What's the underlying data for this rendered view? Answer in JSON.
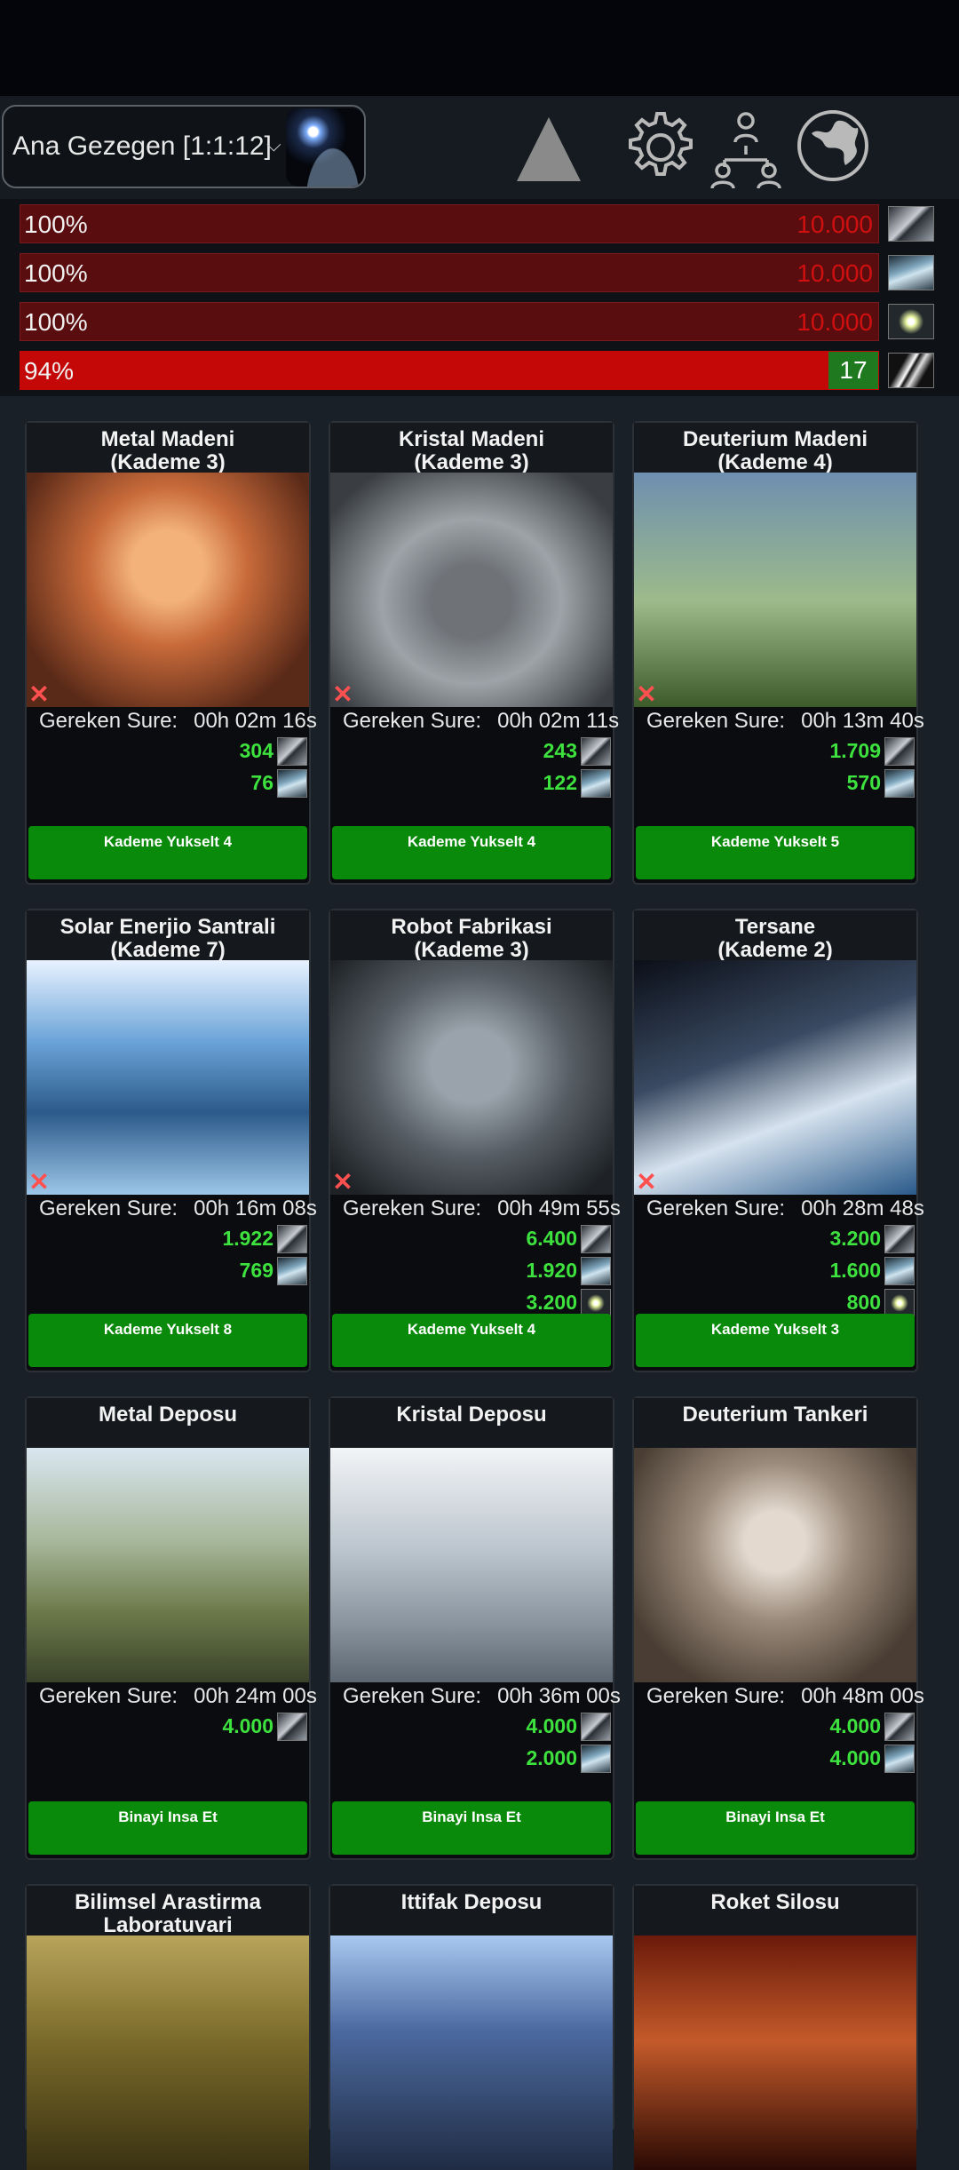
{
  "header": {
    "planet_label": "Ana Gezegen [1:1:12]",
    "icons": [
      "up-arrow-icon",
      "gear-icon",
      "alliance-icon",
      "globe-icon"
    ]
  },
  "resources": [
    {
      "name": "metal",
      "percent": "100%",
      "max": "10.000",
      "icon": "metal-icon"
    },
    {
      "name": "crystal",
      "percent": "100%",
      "max": "10.000",
      "icon": "crystal-icon"
    },
    {
      "name": "deuterium",
      "percent": "100%",
      "max": "10.000",
      "icon": "deuterium-icon"
    },
    {
      "name": "energy",
      "percent": "94%",
      "value": "17",
      "icon": "energy-icon"
    }
  ],
  "time_label": "Gereken Sure:",
  "buildings": [
    {
      "title": "Metal Madeni\n(Kademe 3)",
      "time": "00h 02m 16s",
      "costs": [
        {
          "v": "304",
          "t": "metal"
        },
        {
          "v": "76",
          "t": "crystal"
        }
      ],
      "button": "Kademe Yukselt 4"
    },
    {
      "title": "Kristal Madeni\n(Kademe 3)",
      "time": "00h 02m 11s",
      "costs": [
        {
          "v": "243",
          "t": "metal"
        },
        {
          "v": "122",
          "t": "crystal"
        }
      ],
      "button": "Kademe Yukselt 4"
    },
    {
      "title": "Deuterium Madeni\n(Kademe 4)",
      "time": "00h 13m 40s",
      "costs": [
        {
          "v": "1.709",
          "t": "metal"
        },
        {
          "v": "570",
          "t": "crystal"
        }
      ],
      "button": "Kademe Yukselt 5"
    },
    {
      "title": "Solar Enerjio Santrali\n(Kademe 7)",
      "time": "00h 16m 08s",
      "costs": [
        {
          "v": "1.922",
          "t": "metal"
        },
        {
          "v": "769",
          "t": "crystal"
        }
      ],
      "button": "Kademe Yukselt 8"
    },
    {
      "title": "Robot Fabrikasi\n(Kademe 3)",
      "time": "00h 49m 55s",
      "costs": [
        {
          "v": "6.400",
          "t": "metal"
        },
        {
          "v": "1.920",
          "t": "crystal"
        },
        {
          "v": "3.200",
          "t": "deut"
        }
      ],
      "button": "Kademe Yukselt 4"
    },
    {
      "title": "Tersane\n(Kademe 2)",
      "time": "00h 28m 48s",
      "costs": [
        {
          "v": "3.200",
          "t": "metal"
        },
        {
          "v": "1.600",
          "t": "crystal"
        },
        {
          "v": "800",
          "t": "deut"
        }
      ],
      "button": "Kademe Yukselt 3"
    },
    {
      "title": "Metal Deposu",
      "time": "00h 24m 00s",
      "costs": [
        {
          "v": "4.000",
          "t": "metal"
        }
      ],
      "button": "Binayi Insa Et"
    },
    {
      "title": "Kristal Deposu",
      "time": "00h 36m 00s",
      "costs": [
        {
          "v": "4.000",
          "t": "metal"
        },
        {
          "v": "2.000",
          "t": "crystal"
        }
      ],
      "button": "Binayi Insa Et"
    },
    {
      "title": "Deuterium Tankeri",
      "time": "00h 48m 00s",
      "costs": [
        {
          "v": "4.000",
          "t": "metal"
        },
        {
          "v": "4.000",
          "t": "crystal"
        }
      ],
      "button": "Binayi Insa Et"
    },
    {
      "title": "Bilimsel Arastirma\nLaboratuvari"
    },
    {
      "title": "Ittifak Deposu"
    },
    {
      "title": "Roket Silosu"
    }
  ]
}
